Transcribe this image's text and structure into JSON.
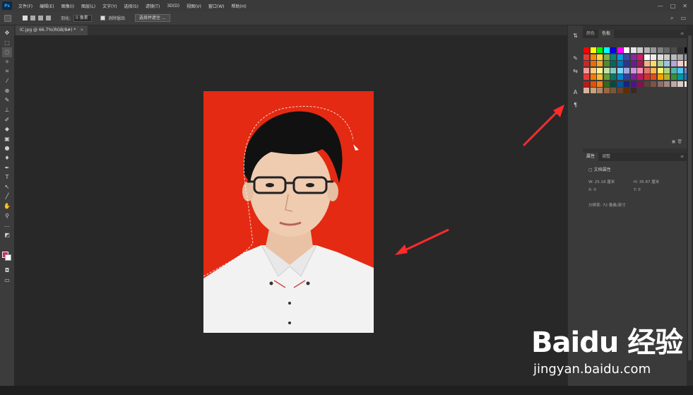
{
  "app": {
    "logo": "Ps"
  },
  "menu": [
    "文件(F)",
    "编辑(E)",
    "图像(I)",
    "图层(L)",
    "文字(Y)",
    "选择(S)",
    "滤镜(T)",
    "3D(D)",
    "视图(V)",
    "窗口(W)",
    "帮助(H)"
  ],
  "window_controls": [
    "—",
    "□",
    "✕"
  ],
  "options": {
    "feather_label": "羽化:",
    "feather_value": "0 像素",
    "antialias_label": "消除锯齿",
    "select_mask_label": "选择并遮住 ..."
  },
  "document": {
    "tab_title": "IC.jpg @ 66.7%(RGB/8#) *",
    "close": "×"
  },
  "panels": {
    "top_tabs": [
      "颜色",
      "色板"
    ],
    "bottom_tabs": [
      "属性",
      "调整"
    ],
    "doc_props_label": "文档属性",
    "w_label": "W: 25.18 厘米",
    "h_label": "H: 35.87 厘米",
    "x_label": "X: 0",
    "y_label": "Y: 0",
    "resolution_label": "分辨率: 72 像素/英寸"
  },
  "swatch_colors": [
    "#ff0000",
    "#ffff00",
    "#00ff00",
    "#00ffff",
    "#0000ff",
    "#ff00ff",
    "#ffffff",
    "#e6e6e6",
    "#cccccc",
    "#b3b3b3",
    "#999999",
    "#808080",
    "#666666",
    "#4d4d4d",
    "#333333",
    "#000000",
    "#e53935",
    "#fb8c00",
    "#fdd835",
    "#7cb342",
    "#00897b",
    "#039be5",
    "#3949ab",
    "#8e24aa",
    "#d81b60",
    "#ffffff",
    "#eeeeee",
    "#dddddd",
    "#cccccc",
    "#bbbbbb",
    "#aaaaaa",
    "#999999",
    "#c62828",
    "#ef6c00",
    "#f9a825",
    "#558b2f",
    "#00695c",
    "#0277bd",
    "#283593",
    "#6a1b9a",
    "#ad1457",
    "#f4b183",
    "#ffd966",
    "#a9d08e",
    "#9bc2e6",
    "#b4a7d6",
    "#f4cccc",
    "#fce5cd",
    "#ef9a9a",
    "#ffcc80",
    "#fff59d",
    "#c5e1a5",
    "#80cbc4",
    "#81d4fa",
    "#9fa8da",
    "#ce93d8",
    "#f48fb1",
    "#e57373",
    "#ffb74d",
    "#fff176",
    "#aed581",
    "#4db6ac",
    "#4fc3f7",
    "#7986cb",
    "#e53935",
    "#f57c00",
    "#fbc02d",
    "#689f38",
    "#00796b",
    "#0288d1",
    "#303f9f",
    "#7b1fa2",
    "#c2185b",
    "#d32f2f",
    "#e64a19",
    "#ffa000",
    "#afb42b",
    "#388e3c",
    "#0097a7",
    "#1976d2",
    "#b71c1c",
    "#e65100",
    "#f57f17",
    "#33691e",
    "#004d40",
    "#01579b",
    "#1a237e",
    "#4a148c",
    "#880e4f",
    "#5d4037",
    "#795548",
    "#8d6e63",
    "#a1887f",
    "#bcaaa4",
    "#d7ccc8",
    "#efebe9",
    "#d7b49e",
    "#c8a27c",
    "#b08968",
    "#9c6644",
    "#7f5539",
    "#6b4226",
    "#583101",
    "#3e2723"
  ],
  "watermark": {
    "brand": "Baidu 经验",
    "url": "jingyan.baidu.com"
  }
}
